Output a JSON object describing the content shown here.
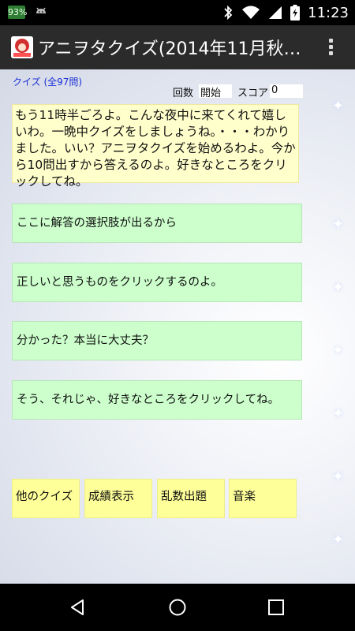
{
  "status_bar": {
    "battery_badge": "93%",
    "time": "11:23",
    "icons": [
      "android-icon",
      "bluetooth-icon",
      "wifi-icon",
      "cell-signal-icon",
      "battery-icon"
    ]
  },
  "action_bar": {
    "title": "アニヲタクイズ(2014年11月秋…",
    "menu_icon": "overflow-menu-icon"
  },
  "header": {
    "quiz_count": "クイズ (全97問)",
    "round_label": "回数",
    "round_value": "開始",
    "score_label": "スコア",
    "score_value": "0"
  },
  "message": "もう11時半ごろよ。こんな夜中に来てくれて嬉しいわ。一晩中クイズをしましょうね。・・・わかりました。いい？アニヲタクイズを始めるわよ。今から10問出すから答えるのよ。好きなところをクリックしてね。",
  "choices": [
    "ここに解答の選択肢が出るから",
    "正しいと思うものをクリックするのよ。",
    "分かった？本当に大丈夫？",
    "そう、それじゃ、好きなところをクリックしてね。"
  ],
  "menu_buttons": [
    "他のクイズ",
    "成績表示",
    "乱数出題",
    "音楽"
  ],
  "nav_bar": {
    "icons": [
      "back-icon",
      "home-icon",
      "recents-icon"
    ]
  },
  "colors": {
    "message_bg": "#ffffcc",
    "choice_bg": "#ccffcc",
    "menu_bg": "#ffff99",
    "quiz_count_text": "#1a2fd6",
    "action_bar_bg": "#2b2b2b"
  }
}
